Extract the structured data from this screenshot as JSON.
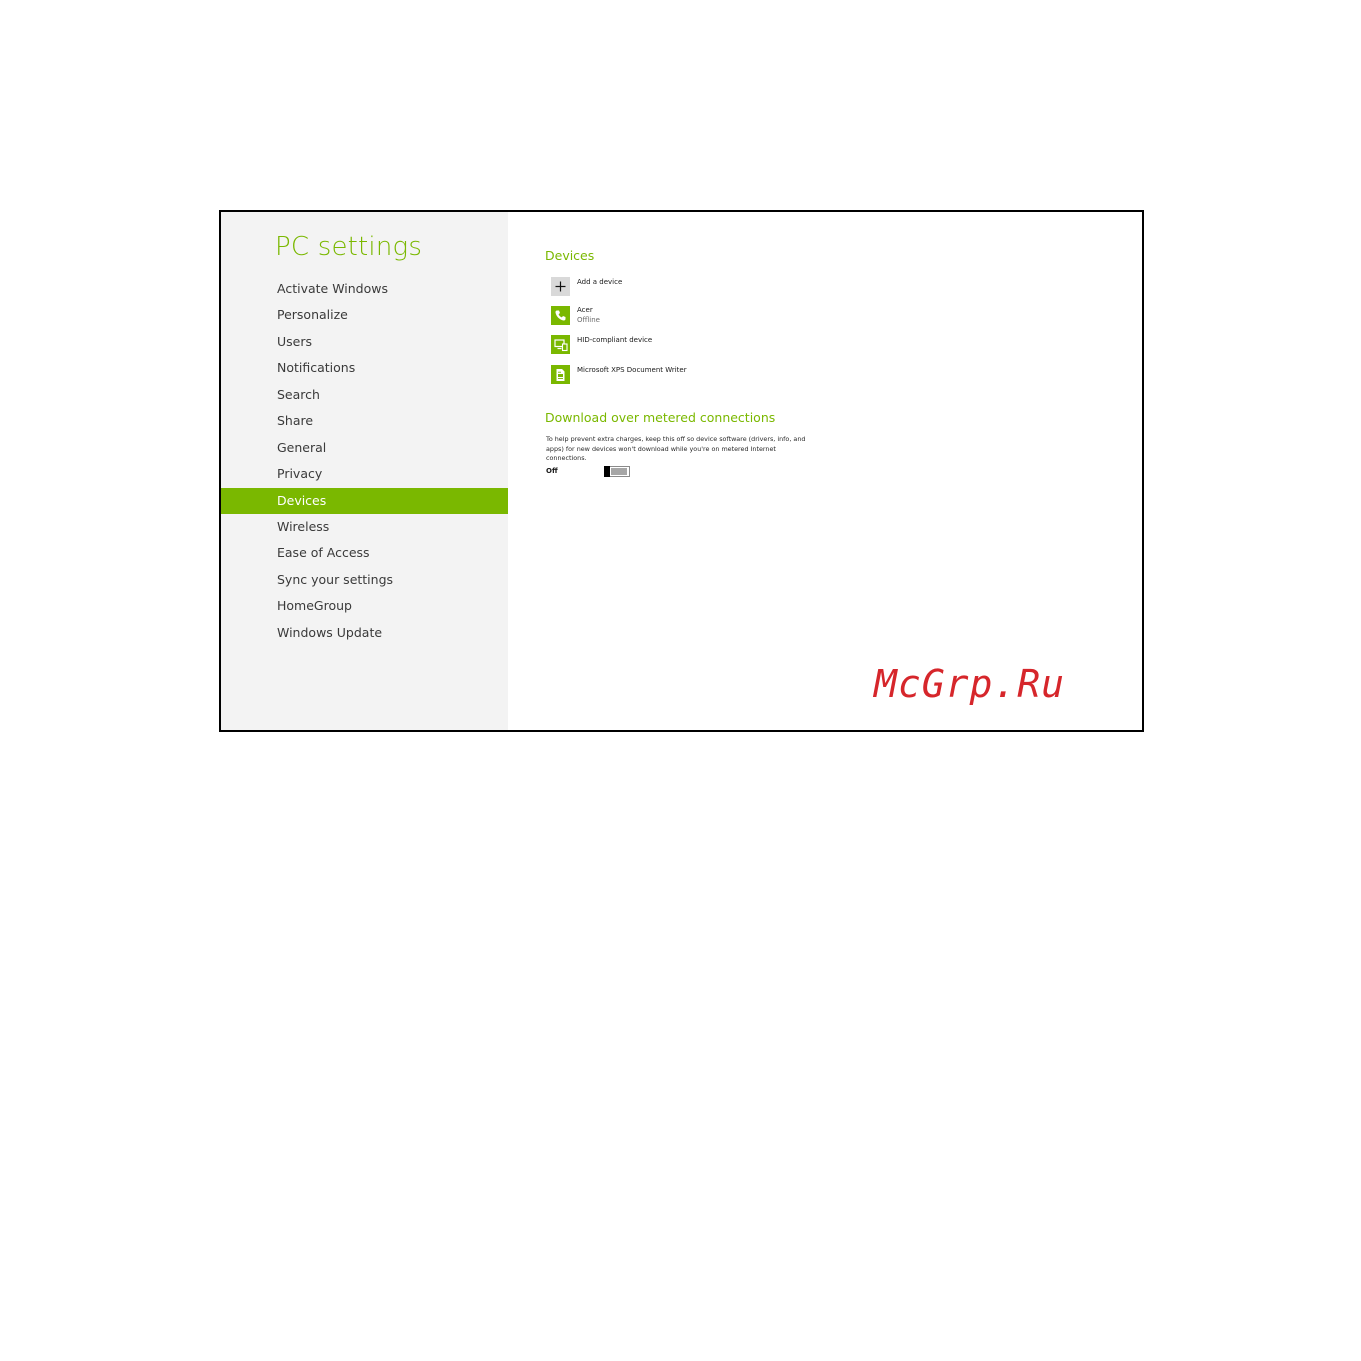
{
  "sidebar": {
    "title": "PC settings",
    "items": [
      {
        "label": "Activate Windows",
        "selected": false
      },
      {
        "label": "Personalize",
        "selected": false
      },
      {
        "label": "Users",
        "selected": false
      },
      {
        "label": "Notifications",
        "selected": false
      },
      {
        "label": "Search",
        "selected": false
      },
      {
        "label": "Share",
        "selected": false
      },
      {
        "label": "General",
        "selected": false
      },
      {
        "label": "Privacy",
        "selected": false
      },
      {
        "label": "Devices",
        "selected": true
      },
      {
        "label": "Wireless",
        "selected": false
      },
      {
        "label": "Ease of Access",
        "selected": false
      },
      {
        "label": "Sync your settings",
        "selected": false
      },
      {
        "label": "HomeGroup",
        "selected": false
      },
      {
        "label": "Windows Update",
        "selected": false
      }
    ]
  },
  "devices": {
    "heading": "Devices",
    "add_label": "Add a device",
    "list": [
      {
        "name": "Acer",
        "status": "Offline",
        "icon": "phone-icon"
      },
      {
        "name": "HID-compliant device",
        "status": "",
        "icon": "monitor-device-icon"
      },
      {
        "name": "Microsoft XPS Document Writer",
        "status": "",
        "icon": "document-printer-icon"
      }
    ]
  },
  "metered": {
    "heading": "Download over metered connections",
    "description": "To help prevent extra charges, keep this off so device software (drivers, info, and apps) for new devices won't download while you're on metered Internet connections.",
    "toggle_label": "Off",
    "toggle_on": false
  },
  "watermark": "McGrp.Ru",
  "colors": {
    "accent": "#7ab800",
    "sidebar_bg": "#f3f3f3",
    "watermark": "#d6262b"
  }
}
